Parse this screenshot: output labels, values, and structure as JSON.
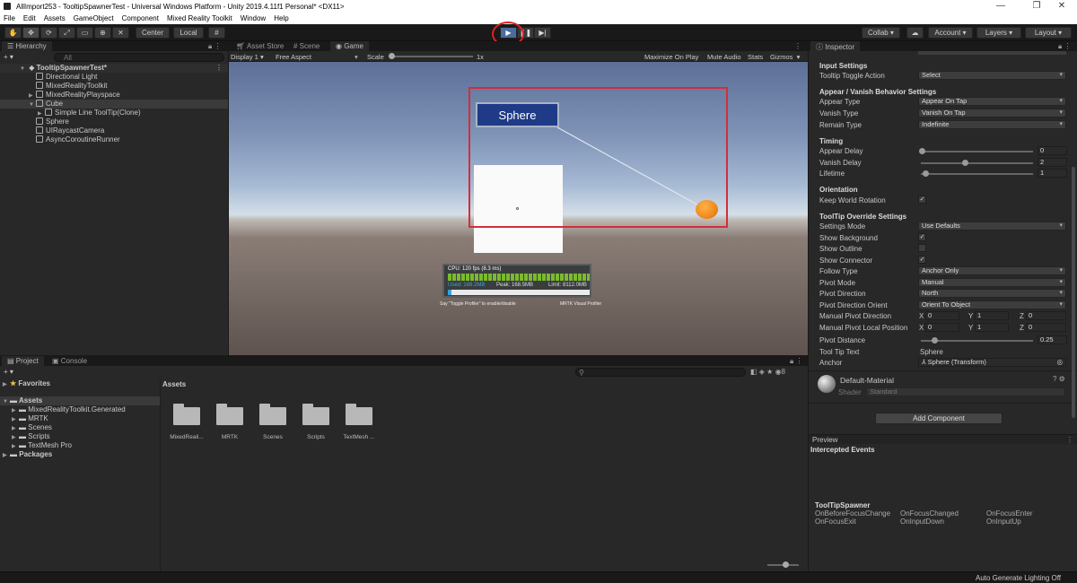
{
  "window": {
    "title": "AllImport253 - TooltipSpawnerTest - Universal Windows Platform - Unity 2019.4.11f1 Personal* <DX11>",
    "controls": [
      "—",
      "❐",
      "✕"
    ]
  },
  "menu": [
    "File",
    "Edit",
    "Assets",
    "GameObject",
    "Component",
    "Mixed Reality Toolkit",
    "Window",
    "Help"
  ],
  "toolbar": {
    "center_label": "Center",
    "local_label": "Local",
    "collab_label": "Collab ▾",
    "account_label": "Account",
    "layers_label": "Layers",
    "layout_label": "Layout"
  },
  "hierarchy": {
    "tab": "Hierarchy",
    "search_placeholder": "All",
    "scene_root": "TooltipSpawnerTest*",
    "items": [
      {
        "label": "Directional Light",
        "indent": 1,
        "arrow": ""
      },
      {
        "label": "MixedRealityToolkit",
        "indent": 1,
        "arrow": ""
      },
      {
        "label": "MixedRealityPlayspace",
        "indent": 1,
        "arrow": "▶"
      },
      {
        "label": "Cube",
        "indent": 1,
        "arrow": "▼"
      },
      {
        "label": "Simple Line ToolTip(Clone)",
        "indent": 2,
        "arrow": "▶"
      },
      {
        "label": "Sphere",
        "indent": 1,
        "arrow": ""
      },
      {
        "label": "UIRaycastCamera",
        "indent": 1,
        "arrow": ""
      },
      {
        "label": "AsyncCoroutineRunner",
        "indent": 1,
        "arrow": ""
      }
    ]
  },
  "center_tabs": [
    "Asset Store",
    "Scene",
    "Game"
  ],
  "gamebar": {
    "display": "Display 1",
    "aspect": "Free Aspect",
    "scale_label": "Scale",
    "scale_value": "1x",
    "maximize": "Maximize On Play",
    "mute": "Mute Audio",
    "stats": "Stats",
    "gizmos": "Gizmos"
  },
  "game": {
    "tooltip_text": "Sphere",
    "profiler": {
      "cpu": "CPU: 120 fps (8.3 ms)",
      "used": "Used: 168.2MB",
      "peak": "Peak: 168.5MB",
      "limit": "Limit: 8112.0MB",
      "footer_left": "Say \"Toggle Profiler\" to enable/disable",
      "footer_right": "MRTK Visual Profiler"
    }
  },
  "project": {
    "tabs": [
      "Project",
      "Console"
    ],
    "favorites": "Favorites",
    "assets_root": "Assets",
    "tree": [
      "MixedRealityToolkit.Generated",
      "MRTK",
      "Scenes",
      "Scripts",
      "TextMesh Pro"
    ],
    "packages": "Packages",
    "breadcrumb": "Assets",
    "count": "8",
    "folders": [
      "MixedReali...",
      "MRTK",
      "Scenes",
      "Scripts",
      "TextMesh ..."
    ]
  },
  "inspector": {
    "tab": "Inspector",
    "input_settings": "Input Settings",
    "toggle_action_label": "Tooltip Toggle Action",
    "toggle_action_value": "Select",
    "appear_header": "Appear / Vanish Behavior Settings",
    "appear_type_label": "Appear Type",
    "appear_type_value": "Appear On Tap",
    "vanish_type_label": "Vanish Type",
    "vanish_type_value": "Vanish On Tap",
    "remain_type_label": "Remain Type",
    "remain_type_value": "Indefinite",
    "timing_header": "Timing",
    "appear_delay_label": "Appear Delay",
    "appear_delay_value": "0",
    "vanish_delay_label": "Vanish Delay",
    "vanish_delay_value": "2",
    "lifetime_label": "Lifetime",
    "lifetime_value": "1",
    "orientation_header": "Orientation",
    "keep_world_label": "Keep World Rotation",
    "override_header": "ToolTip Override Settings",
    "settings_mode_label": "Settings Mode",
    "settings_mode_value": "Use Defaults",
    "show_bg_label": "Show Background",
    "show_outline_label": "Show Outline",
    "show_connector_label": "Show Connector",
    "follow_type_label": "Follow Type",
    "follow_type_value": "Anchor Only",
    "pivot_mode_label": "Pivot Mode",
    "pivot_mode_value": "Manual",
    "pivot_dir_label": "Pivot Direction",
    "pivot_dir_value": "North",
    "pivot_orient_label": "Pivot Direction Orient",
    "pivot_orient_value": "Orient To Object",
    "manual_pivot_dir_label": "Manual Pivot Direction",
    "manual_pivot_dir": {
      "x": "0",
      "y": "1",
      "z": "0"
    },
    "manual_pivot_local_label": "Manual Pivot Local Position",
    "manual_pivot_local": {
      "x": "0",
      "y": "1",
      "z": "0"
    },
    "pivot_distance_label": "Pivot Distance",
    "pivot_distance_value": "0.25",
    "tooltip_text_label": "Tool Tip Text",
    "tooltip_text_value": "Sphere",
    "anchor_label": "Anchor",
    "anchor_value": "Sphere (Transform)",
    "material_name": "Default-Material",
    "shader_label": "Shader",
    "shader_value": "Standard",
    "add_component": "Add Component",
    "preview_label": "Preview",
    "intercepted_label": "Intercepted Events",
    "spawner_title": "ToolTipSpawner",
    "events": [
      "OnBeforeFocusChange",
      "OnFocusChanged",
      "OnFocusEnter",
      "OnFocusExit",
      "OnInputDown",
      "OnInputUp"
    ]
  },
  "status": {
    "lighting": "Auto Generate Lighting Off"
  },
  "colors": {
    "highlight_box": "#d42d3a",
    "play_active": "#4a6c9e",
    "tooltip_bg": "#1f3b87",
    "sphere": "#f08a1c"
  }
}
